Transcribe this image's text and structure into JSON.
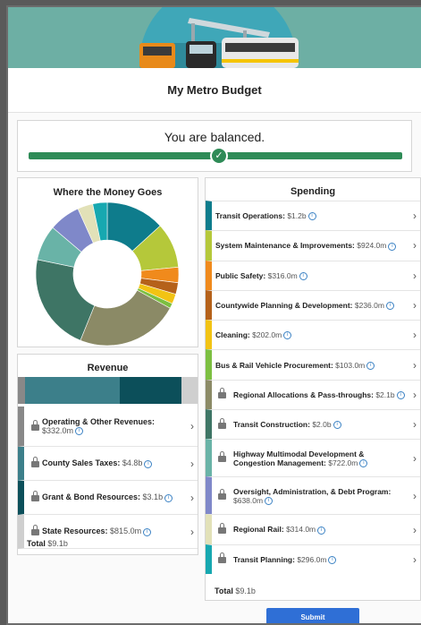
{
  "header": {
    "title": "My Metro Budget"
  },
  "balance": {
    "status_text": "You are balanced.",
    "progress_fraction": 1.0,
    "check_icon": "check-icon"
  },
  "donut": {
    "title": "Where the Money Goes",
    "segments": [
      {
        "name": "Transit Operations",
        "value": 1.2,
        "color": "#0e7c8c"
      },
      {
        "name": "System Maintenance & Improvements",
        "value": 0.924,
        "color": "#b5c83a"
      },
      {
        "name": "Public Safety",
        "value": 0.316,
        "color": "#f08a1c"
      },
      {
        "name": "Countywide Planning & Development",
        "value": 0.236,
        "color": "#b5611a"
      },
      {
        "name": "Cleaning",
        "value": 0.202,
        "color": "#f2c313"
      },
      {
        "name": "Bus & Rail Vehicle Procurement",
        "value": 0.103,
        "color": "#7cbf41"
      },
      {
        "name": "Regional Allocations & Pass-throughs",
        "value": 2.1,
        "color": "#8b8a66"
      },
      {
        "name": "Transit Construction",
        "value": 2.0,
        "color": "#3e7565"
      },
      {
        "name": "Highway Multimodal Development & Congestion Management",
        "value": 0.722,
        "color": "#69b3a7"
      },
      {
        "name": "Oversight, Administration, & Debt Program",
        "value": 0.638,
        "color": "#7f88c9"
      },
      {
        "name": "Regional Rail",
        "value": 0.314,
        "color": "#e2e1b8"
      },
      {
        "name": "Transit Planning",
        "value": 0.296,
        "color": "#17a8b0"
      }
    ]
  },
  "revenue": {
    "title": "Revenue",
    "stack": [
      {
        "value": 0.332,
        "color": "#888888"
      },
      {
        "value": 4.8,
        "color": "#3c7f8a"
      },
      {
        "value": 3.1,
        "color": "#0c4f5a"
      },
      {
        "value": 0.815,
        "color": "#cfcfcf"
      }
    ],
    "items": [
      {
        "label": "Operating & Other Revenues:",
        "amount": "$332.0m",
        "color": "#888888"
      },
      {
        "label": "County Sales Taxes:",
        "amount": "$4.8b",
        "color": "#3c7f8a"
      },
      {
        "label": "Grant & Bond Resources:",
        "amount": "$3.1b",
        "color": "#0c4f5a"
      },
      {
        "label": "State Resources:",
        "amount": "$815.0m",
        "color": "#cfcfcf"
      }
    ],
    "total_label": "Total",
    "total_value": "$9.1b"
  },
  "spending": {
    "title": "Spending",
    "items": [
      {
        "label": "Transit Operations:",
        "amount": "$1.2b",
        "color": "#0e7c8c",
        "locked": false
      },
      {
        "label": "System Maintenance & Improvements:",
        "amount": "$924.0m",
        "color": "#b5c83a",
        "locked": false
      },
      {
        "label": "Public Safety:",
        "amount": "$316.0m",
        "color": "#f08a1c",
        "locked": false
      },
      {
        "label": "Countywide Planning & Development:",
        "amount": "$236.0m",
        "color": "#b5611a",
        "locked": false
      },
      {
        "label": "Cleaning:",
        "amount": "$202.0m",
        "color": "#f2c313",
        "locked": false
      },
      {
        "label": "Bus & Rail Vehicle Procurement:",
        "amount": "$103.0m",
        "color": "#7cbf41",
        "locked": false
      },
      {
        "label": "Regional Allocations & Pass-throughs:",
        "amount": "$2.1b",
        "color": "#8b8a66",
        "locked": true
      },
      {
        "label": "Transit Construction:",
        "amount": "$2.0b",
        "color": "#3e7565",
        "locked": true
      },
      {
        "label": "Highway Multimodal Development & Congestion Management:",
        "amount": "$722.0m",
        "color": "#69b3a7",
        "locked": true
      },
      {
        "label": "Oversight, Administration, & Debt Program:",
        "amount": "$638.0m",
        "color": "#7f88c9",
        "locked": true
      },
      {
        "label": "Regional Rail:",
        "amount": "$314.0m",
        "color": "#e2e1b8",
        "locked": true
      },
      {
        "label": "Transit Planning:",
        "amount": "$296.0m",
        "color": "#17a8b0",
        "locked": true
      }
    ],
    "total_label": "Total",
    "total_value": "$9.1b"
  },
  "submit_label": "Submit"
}
